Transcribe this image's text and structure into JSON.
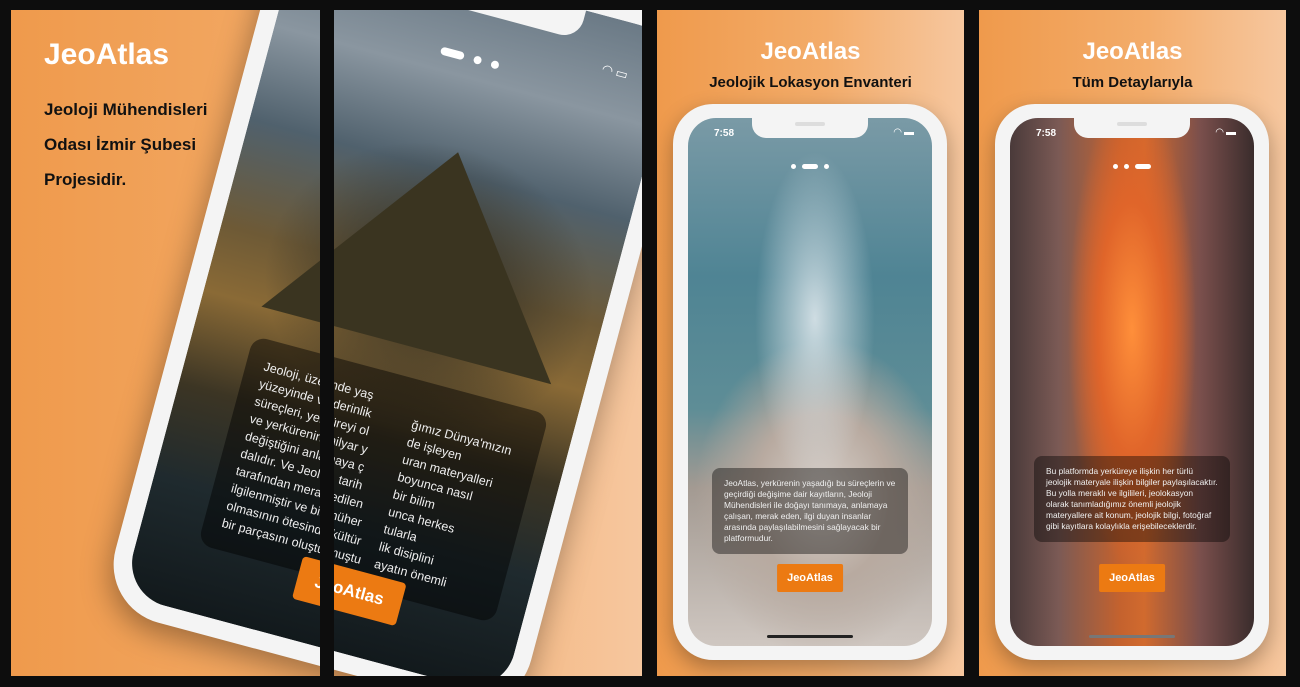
{
  "panel1": {
    "title": "JeoAtlas",
    "subtitle_lines": [
      "Jeoloji Mühendisleri",
      "Odası İzmir Şubesi",
      "Projesidir."
    ],
    "card_left_lines": [
      "Jeoloji, üzerinde yaş",
      "yüzeyinde ve derinlik",
      "süreçleri, yerküreyi ol",
      "ve yerkürenin milyar y",
      "değiştiğini anlamaya ç",
      "dalıdır. Ve Jeoloji, tarih",
      "tarafından merak edilen",
      "ilgilenmiştir ve bir müher",
      "olmasının ötesinde kültür",
      "bir parçasını oluşturmuştu"
    ],
    "card_right_lines": [
      "ğımız Dünya'mızın",
      "de işleyen",
      "uran materyalleri",
      "boyunca nasıl",
      "bir bilim",
      "unca herkes",
      "tularla",
      "lik disiplini",
      "ayatın önemli"
    ],
    "button_label": "JeoAtlas"
  },
  "panel2": {
    "title": "JeoAtlas",
    "subtitle": "Jeolojik Lokasyon Envanteri",
    "time": "7:58",
    "status_icons": "wifi battery",
    "card_text": "JeoAtlas, yerkürenin yaşadığı bu süreçlerin ve geçirdiği değişime dair kayıtların, Jeoloji Mühendisleri ile doğayı tanımaya, anlamaya çalışan, merak eden, ilgi duyan insanlar arasında paylaşılabilmesini sağlayacak bir platformudur.",
    "button_label": "JeoAtlas"
  },
  "panel3": {
    "title": "JeoAtlas",
    "subtitle": "Tüm Detaylarıyla",
    "time": "7:58",
    "status_icons": "wifi battery",
    "card_text": "Bu platformda yerküreye ilişkin her türlü jeolojik materyale ilişkin bilgiler paylaşılacaktır. Bu yolla meraklı ve ilgilileri, jeolokasyon olarak tanımladığımız önemli jeolojik materyallere ait konum, jeolojik bilgi, fotoğraf gibi kayıtlara kolaylıkla erişebileceklerdir.",
    "button_label": "JeoAtlas"
  },
  "colors": {
    "accent": "#ec7a12",
    "background": "#ef9a4c"
  }
}
